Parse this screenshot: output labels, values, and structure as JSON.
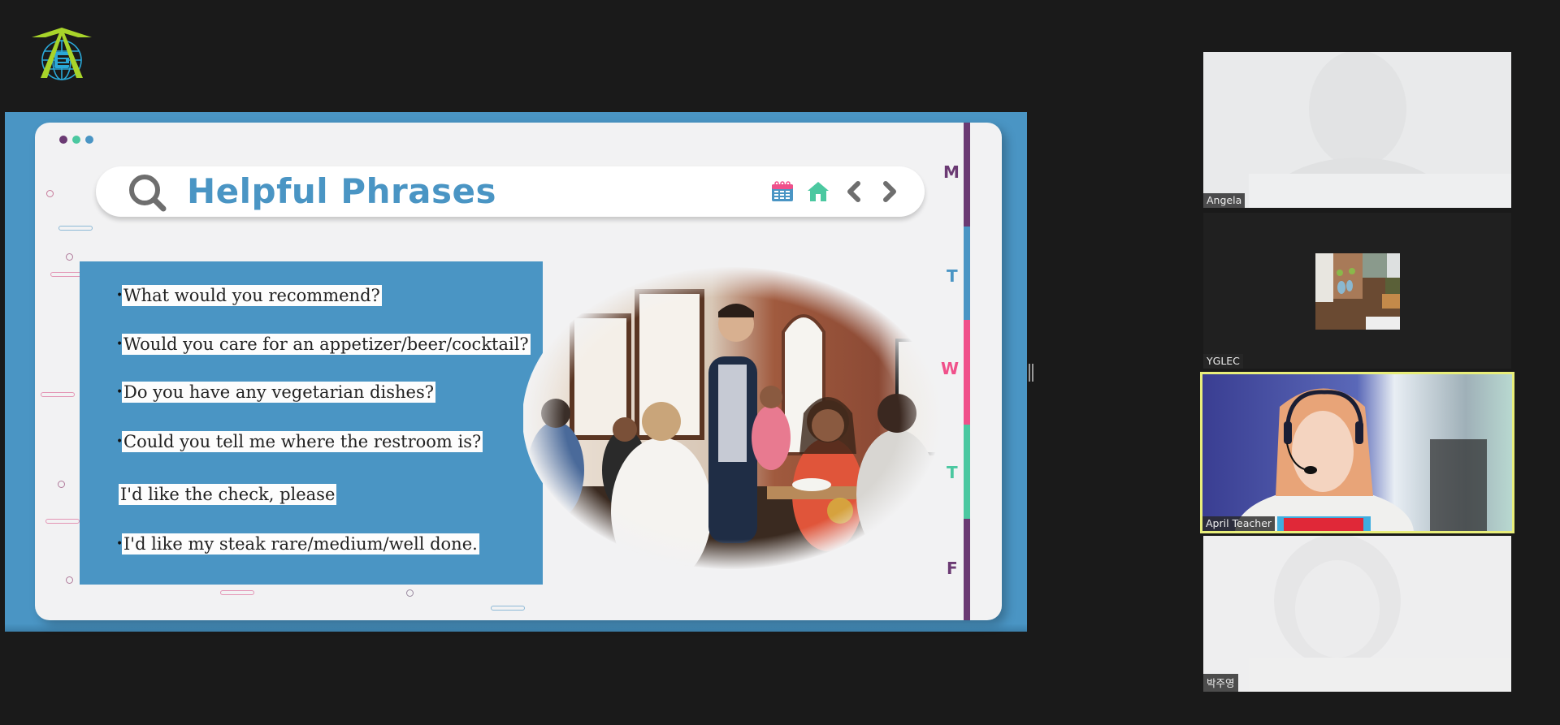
{
  "app": {
    "logo_icon": "yglec-globe-arrow-logo-icon",
    "split_handle_icon": "resize-handle-icon"
  },
  "slide": {
    "window_dots": [
      {
        "name": "dot-purple",
        "color": "#6b3a73"
      },
      {
        "name": "dot-green",
        "color": "#4bc8a0"
      },
      {
        "name": "dot-blue",
        "color": "#4a95c4"
      }
    ],
    "title": "Helpful Phrases",
    "title_icon": "search-icon",
    "toolbar": [
      {
        "name": "calendar-icon",
        "label": "Calendar"
      },
      {
        "name": "home-icon",
        "label": "Home"
      },
      {
        "name": "chevron-left-icon",
        "label": "Previous"
      },
      {
        "name": "chevron-right-icon",
        "label": "Next"
      }
    ],
    "days": [
      {
        "label": "M",
        "color": "#6b3a73"
      },
      {
        "label": "T",
        "color": "#4a95c4"
      },
      {
        "label": "W",
        "color": "#f0508a"
      },
      {
        "label": "T",
        "color": "#4bc8a0"
      },
      {
        "label": "F",
        "color": "#6b3a73"
      }
    ],
    "phrases": [
      {
        "bullet": "•",
        "text": "What would you recommend?"
      },
      {
        "bullet": "•",
        "text": "Would you care for an appetizer/beer/cocktail?"
      },
      {
        "bullet": "•",
        "text": "Do you have any vegetarian dishes?"
      },
      {
        "bullet": "•",
        "text": "Could you tell me where the restroom is?"
      },
      {
        "bullet": "",
        "text": "I'd like the check, please"
      },
      {
        "bullet": "•",
        "text": "I'd like my steak rare/medium/well done."
      }
    ],
    "photo_alt": "Waiter serving diners in a restaurant",
    "colors": {
      "accent_blue": "#4a95c4",
      "accent_purple": "#6b3a73",
      "accent_pink": "#f0508a",
      "accent_green": "#4bc8a0"
    }
  },
  "participants": [
    {
      "name": "Angela",
      "video": "washed-out",
      "active": false
    },
    {
      "name": "YGLEC",
      "video": "profile-picture",
      "active": false
    },
    {
      "name": "April Teacher",
      "video": "live",
      "active": true
    },
    {
      "name": "박주영",
      "video": "washed-out",
      "active": false
    }
  ],
  "active_speaker_color": "#e8ee7a"
}
